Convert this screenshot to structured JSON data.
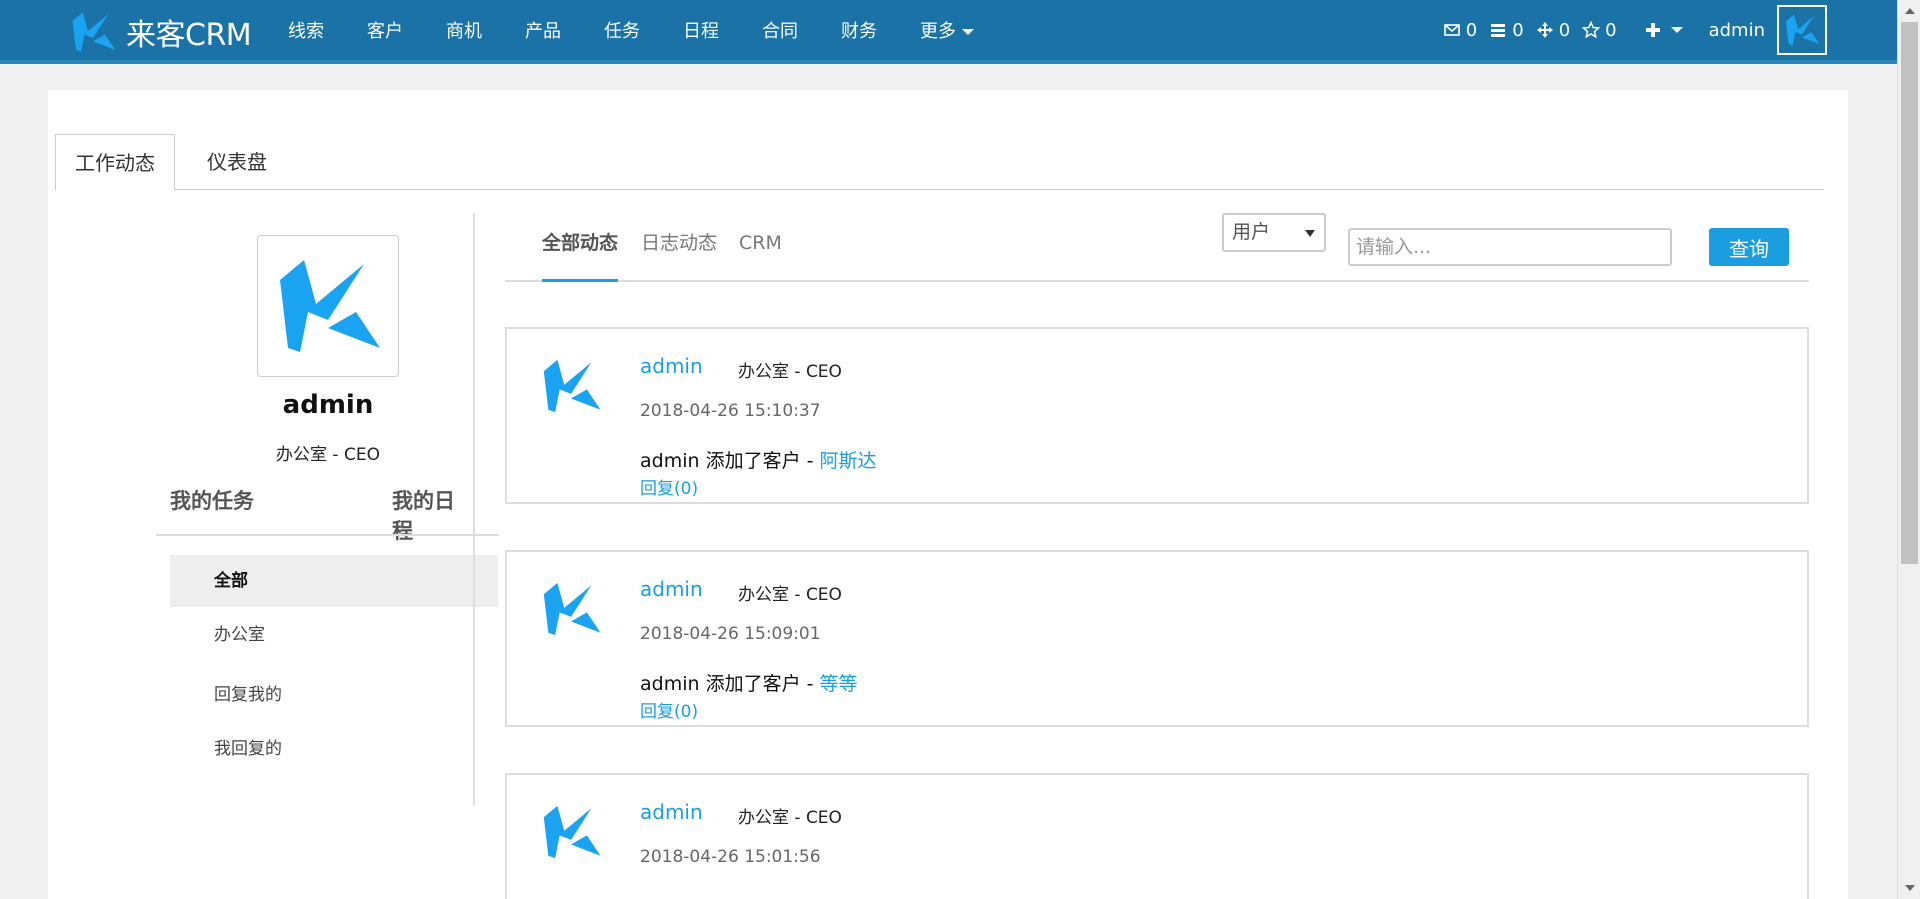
{
  "brand": {
    "name": "来客CRM",
    "icon": "k-logo-icon"
  },
  "nav": {
    "items": [
      {
        "label": "线索"
      },
      {
        "label": "客户"
      },
      {
        "label": "商机"
      },
      {
        "label": "产品"
      },
      {
        "label": "任务"
      },
      {
        "label": "日程"
      },
      {
        "label": "合同"
      },
      {
        "label": "财务"
      }
    ],
    "more_label": "更多"
  },
  "header_right": {
    "counters": [
      {
        "icon": "envelope-icon",
        "count": "0"
      },
      {
        "icon": "list-icon",
        "count": "0"
      },
      {
        "icon": "move-icon",
        "count": "0"
      },
      {
        "icon": "star-icon",
        "count": "0"
      }
    ],
    "add_icon": "plus-icon",
    "username": "admin"
  },
  "top_tabs": [
    {
      "label": "工作动态",
      "active": true
    },
    {
      "label": "仪表盘",
      "active": false
    }
  ],
  "profile": {
    "name": "admin",
    "dept": "办公室 - CEO",
    "my_tasks": "我的任务",
    "my_schedule": "我的日程"
  },
  "filters": [
    {
      "label": "全部",
      "active": true
    },
    {
      "label": "办公室",
      "active": false
    },
    {
      "label": "回复我的",
      "active": false
    },
    {
      "label": "我回复的",
      "active": false
    }
  ],
  "feed_tabs": [
    {
      "label": "全部动态",
      "active": true
    },
    {
      "label": "日志动态",
      "active": false
    },
    {
      "label": "CRM",
      "active": false
    }
  ],
  "search": {
    "select_value": "用户",
    "placeholder": "请输入...",
    "button_label": "查询"
  },
  "feed": [
    {
      "user": "admin",
      "dept": "办公室 - CEO",
      "time": "2018-04-26 15:10:37",
      "action": "admin 添加了客户 - ",
      "target": "阿斯达",
      "reply": "回复(0)"
    },
    {
      "user": "admin",
      "dept": "办公室 - CEO",
      "time": "2018-04-26 15:09:01",
      "action": "admin 添加了客户 - ",
      "target": "等等",
      "reply": "回复(0)"
    },
    {
      "user": "admin",
      "dept": "办公室 - CEO",
      "time": "2018-04-26 15:01:56",
      "action": "",
      "target": "",
      "reply": ""
    }
  ],
  "colors": {
    "navbar": "#1a72a6",
    "accent": "#1a9ee0",
    "logo": "#1aa3f0"
  }
}
